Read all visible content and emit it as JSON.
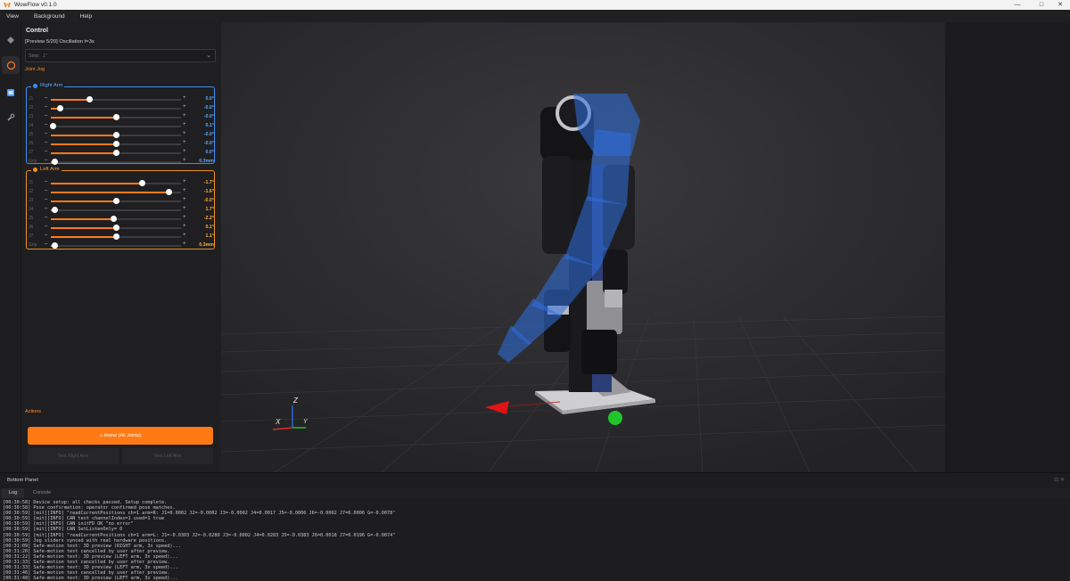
{
  "window": {
    "title": "WowFlow v0.1.0",
    "minimize": "—",
    "maximize": "□",
    "close": "✕"
  },
  "menu": [
    "View",
    "Background",
    "Help"
  ],
  "control": {
    "title": "Control",
    "preview_text": "[Preview 5/20] Oscillation t=3s",
    "step_label": "Step:",
    "step_value": "1°",
    "joint_jog_label": "Joint Jog"
  },
  "right_arm": {
    "title": "Right Arm",
    "color": "#3a8ff0",
    "joints": [
      {
        "name": "J1",
        "value": "0.0°",
        "level": 0.3
      },
      {
        "name": "J2",
        "value": "-0.0°",
        "level": 0.07
      },
      {
        "name": "J3",
        "value": "-0.0°",
        "level": 0.5
      },
      {
        "name": "J4",
        "value": "0.1°",
        "level": 0.02
      },
      {
        "name": "J5",
        "value": "-0.0°",
        "level": 0.5
      },
      {
        "name": "J6",
        "value": "-0.0°",
        "level": 0.5
      },
      {
        "name": "J7",
        "value": "0.0°",
        "level": 0.5
      },
      {
        "name": "Grip",
        "value": "0.3mm",
        "level": 0.03
      }
    ]
  },
  "left_arm": {
    "title": "Left Arm",
    "color": "#f0901f",
    "joints": [
      {
        "name": "J1",
        "value": "-1.7°",
        "level": 0.7
      },
      {
        "name": "J2",
        "value": "-1.6°",
        "level": 0.91
      },
      {
        "name": "J3",
        "value": "-0.0°",
        "level": 0.5
      },
      {
        "name": "J4",
        "value": "1.7°",
        "level": 0.03
      },
      {
        "name": "J5",
        "value": "-2.2°",
        "level": 0.48
      },
      {
        "name": "J6",
        "value": "0.1°",
        "level": 0.5
      },
      {
        "name": "J7",
        "value": "1.1°",
        "level": 0.5
      },
      {
        "name": "Grip",
        "value": "0.3mm",
        "level": 0.03
      }
    ]
  },
  "actions": {
    "title": "Actions",
    "home_button": "⌂ Home (All Joints)",
    "test_right": "Test Right Arm",
    "test_left": "Test Left Arm"
  },
  "axes": {
    "x": "X",
    "y": "Y",
    "z": "Z"
  },
  "bottom_panel": {
    "title": "Bottom Panel",
    "tabs": [
      "Log",
      "Console"
    ],
    "log_lines": [
      "[00:30:58] Device setup: all checks passed. Setup complete.",
      "[00:30:58] Pose confirmation: operator confirmed pose matches.",
      "[00:30:59] [mit][INFO] \"readCurrentPositions ch=1 arm=R: J1=0.0002 J2=-0.0002 J3=-0.0002 J4=0.0017 J5=-0.0006 J6=-0.0002 J7=0.0006 G=-0.0078\"",
      "[00:30:59] [mit][INFO] CAN test channelIndex=1 used=1 true",
      "[00:30:59] [mit][INFO] CAN initFD OK \"no error\"",
      "[00:30:59] [mit][INFO] CAN SetListenOnly= 0",
      "[00:30:59] [mit][INFO] \"readCurrentPositions ch=1 arm=L: J1=-0.0303 J2=-0.0280 J3=-0.0002 J4=0.0283 J5=-0.0383 J6=0.0018 J7=0.0196 G=-0.0074\"",
      "[00:30:59] Jog sliders synced with real hardware positions.",
      "[00:31:09] Safe-motion test: 3D preview (RIGHT arm, 3x speed)...",
      "[00:31:20] Safe-motion test cancelled by user after preview.",
      "[00:31:22] Safe-motion test: 3D preview (LEFT arm, 3x speed)...",
      "[00:31:33] Safe-motion test cancelled by user after preview.",
      "[00:31:33] Safe-motion test: 3D preview (LEFT arm, 3x speed)...",
      "[00:31:46] Safe-motion test cancelled by user after preview.",
      "[00:31:48] Safe-motion test: 3D preview (LEFT arm, 3x speed)..."
    ]
  }
}
